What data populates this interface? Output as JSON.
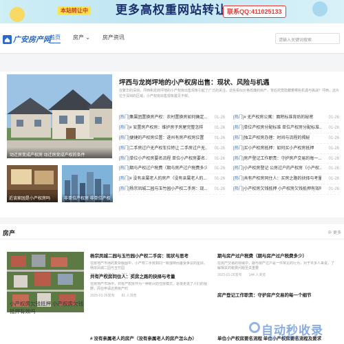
{
  "banner": {
    "tag": "本站转让中",
    "headline": "更多高权重网站转让",
    "contact": "联系QQ:411025133"
  },
  "header": {
    "logo": "广安房产网",
    "nav": [
      "首页",
      "房产",
      "房产资讯"
    ],
    "nav_dropdown": "⌄",
    "search_placeholder": "请输入关键词搜索"
  },
  "featured": {
    "hero_caption": "动迁房变成产权房 动迁房变成产权的条件",
    "thumbs": [
      "近谈家园是小产权房吗",
      "非单位产权房 非单位产权"
    ],
    "top_title": "坪西与龙岗坪地的小产权房出售：现状、风险与机遇",
    "top_summary": "在繁华的深圳，坪西和龙岗坪地的小产权房出售现象引起了广泛的关注。这些看似价格低廉的房产，背后究竟隐藏着哪些机遇与挑战？坪西，这片位于深圳的区域，小产权房出售现象屡见不鲜。",
    "left_news": [
      {
        "tag": "[热门]",
        "title": "集属团置换房产权：农村置换房如何确定...",
        "date": "01-26"
      },
      {
        "tag": "[热门]",
        "title": "# 安置房产权房：维护房子房屋完整怎样",
        "date": "01-26"
      },
      {
        "tag": "[热门]",
        "title": "便捷的产权房位置：遂州有房产权房位置",
        "date": "01-26"
      },
      {
        "tag": "[热门]",
        "title": "二手房过户无产权车位转让 二手房过户无...",
        "date": "01-26"
      },
      {
        "tag": "[热门]",
        "title": "单位小产权房要名流程 单位小产权房要名...",
        "date": "01-26"
      },
      {
        "tag": "[热门]",
        "title": "期与产权过户税费（期与房产过户税费多少）",
        "date": "01-26"
      },
      {
        "tag": "[热门]",
        "title": "# 没有亲属老人的房产（没有亲属老人的...",
        "date": "01-26"
      },
      {
        "tag": "[热门]",
        "title": "杨宗凤城二园与玉竹园小产权二手房：现...",
        "date": "01-26"
      }
    ],
    "right_news": [
      {
        "tag": "[热门]",
        "title": "# 无产权房公寓：面积标准背后的秘密",
        "date": "01-26"
      },
      {
        "tag": "[热门]",
        "title": "单位产权房分配标准 单位产权房分配标准...",
        "date": "01-26"
      },
      {
        "tag": "[热门]",
        "title": "独立产权房办理：时间与流程的揭秘",
        "date": "01-26"
      },
      {
        "tag": "[热门]",
        "title": "买小产权房抵押：如何买小产权房抵押",
        "date": "01-26"
      },
      {
        "tag": "[热门]",
        "title": "房产登记工作职责：守护房产交易的每一...",
        "date": "01-26"
      },
      {
        "tag": "[热门]",
        "title": "小产权房登记 公房过户的产权房（小产权...",
        "date": "01-26"
      },
      {
        "tag": "[热门]",
        "title": "共有产权房同住人：买房之路的抉择与考量",
        "date": "01-26"
      },
      {
        "tag": "[热门]",
        "title": "小产权房欠钱抵押 小产权房欠钱抵押有效吗",
        "date": "01-26"
      }
    ]
  },
  "section": {
    "heading": "房产",
    "more": "更多",
    "aerial_caption": "小产权房欠钱抵押 小产权房欠钱抵押有效吗",
    "cards": [
      {
        "title": "杨宗凤城二园与玉竹园小产权二手房：现状与思考",
        "summary": "在房地产市场的复杂版图中，小产权二手房如同一颗独特而备受争议的星辰。杨宗凤城二园与玉竹园",
        "meta": "2025-01-26发布　　177 人浏览"
      },
      {
        "title": "期与房产过户税费（期与房产过户税费多少）",
        "summary": "在房产交易的领域中，期与房产过户是一件常见的行为，对于许多人来说，了解相关的税费问题至关重要",
        "meta": "2025-01-26发布　　144 人浏览"
      },
      {
        "title": "共有产权房同住人：买房之路的抉择与考量",
        "summary": "在房地产市场中，共有产权房作为一种新兴的住房模式，逐渐走进了人们的视野。而在申请这类房产时",
        "meta": "2025-01-26发布　　81 人浏览"
      },
      {
        "title": "房产登记工作职责：守护房产交易的每一个细节",
        "summary": "",
        "meta": ""
      },
      {
        "title": "# 没有亲属老人的房产（没有亲属老人的房产怎么办）",
        "summary": "",
        "meta": ""
      },
      {
        "title": "单位小产权房要名流程 单位小产权房要名流程及要求",
        "summary": "",
        "meta": ""
      }
    ]
  },
  "watermark": {
    "main": "自动秒收录",
    "sub": "— 来访 → 自动收录 —"
  },
  "colors": {
    "accent": "#2a6ac8",
    "banner": "#cfeef6"
  }
}
